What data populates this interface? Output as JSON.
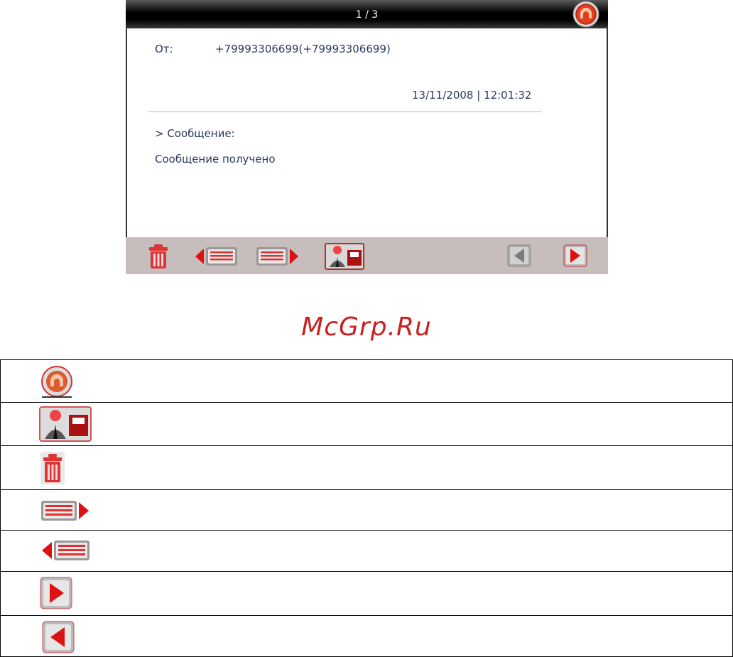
{
  "screen": {
    "page_counter": "1 / 3",
    "from_label": "От:",
    "from_value": "+79993306699(+79993306699)",
    "datetime": "13/11/2008 | 12:01:32",
    "message_header": "> Сообщение:",
    "message_body": "Сообщение получено"
  },
  "toolbar": {
    "items": [
      "trash-icon",
      "previous-message-icon",
      "next-message-icon",
      "save-contact-icon",
      "page-back-icon",
      "page-forward-icon"
    ]
  },
  "watermark": "McGrp.Ru",
  "legend": {
    "rows": [
      "home-icon",
      "save-contact-icon",
      "trash-icon",
      "next-message-icon",
      "previous-message-icon",
      "page-forward-icon",
      "page-back-icon"
    ]
  },
  "colors": {
    "accent_red": "#cc1f1f",
    "toolbar_bg": "#c7bdbd",
    "text": "#2d3a5c"
  }
}
